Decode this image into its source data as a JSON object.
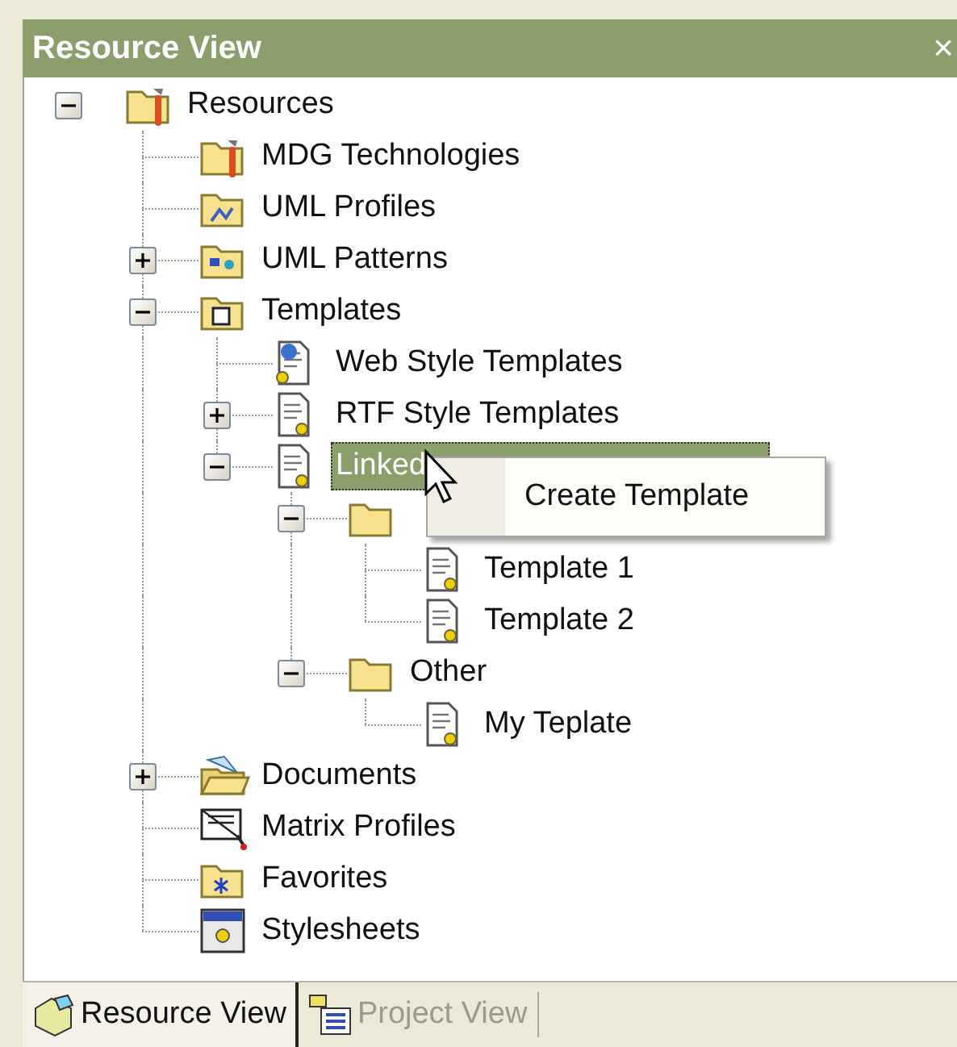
{
  "window": {
    "title": "Resource View",
    "close": "×"
  },
  "tree": [
    {
      "label": "Resources",
      "selected": false,
      "expanded": true,
      "children": [
        {
          "label": "MDG Technologies",
          "selected": false
        },
        {
          "label": "UML Profiles",
          "selected": false
        },
        {
          "label": "UML Patterns",
          "selected": false,
          "expanded": false
        },
        {
          "label": "Templates",
          "selected": false,
          "expanded": true,
          "children": [
            {
              "label": "Web Style Templates",
              "selected": false
            },
            {
              "label": "RTF Style Templates",
              "selected": false,
              "expanded": false
            },
            {
              "label": "Linked",
              "selected": true,
              "expanded": true,
              "children": [
                {
                  "selected": false,
                  "expanded": true,
                  "children": [
                    {
                      "label": "Template 1",
                      "selected": false
                    },
                    {
                      "label": "Template 2",
                      "selected": false
                    }
                  ]
                },
                {
                  "label": "Other",
                  "selected": false,
                  "expanded": true,
                  "children": [
                    {
                      "label": "My Teplate",
                      "selected": false
                    }
                  ]
                }
              ]
            }
          ]
        },
        {
          "label": "Documents",
          "selected": false,
          "expanded": false
        },
        {
          "label": "Matrix Profiles",
          "selected": false
        },
        {
          "label": "Favorites",
          "selected": false
        },
        {
          "label": "Stylesheets",
          "selected": false
        }
      ]
    }
  ],
  "context_menu": {
    "items": [
      "Create Template"
    ]
  },
  "tabs": [
    {
      "label": "Resource View",
      "selected": true
    },
    {
      "label": "Project View",
      "selected": false
    }
  ]
}
